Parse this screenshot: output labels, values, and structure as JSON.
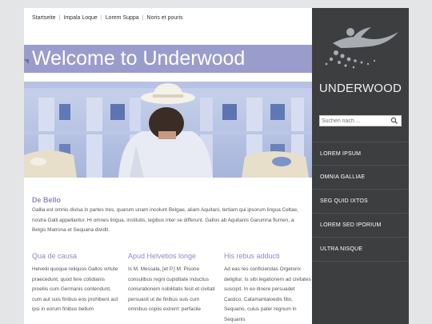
{
  "topnav": {
    "items": [
      "Startseite",
      "Impala Loque",
      "Lorem Suppa",
      "Noris et pouris"
    ]
  },
  "hero": {
    "title": "Welcome to Underwood"
  },
  "intro": {
    "title": "De Bello",
    "text": "Gallia est omnis divisa in partes tres, quarum unam incolunt Belgae, aliam Aquitani, tertiam qui ipsorum lingua Celtae, nostra Galli appellantur. Hi omnes lingua, institutis, legibus inter se differunt. Gallos ab Aquitanis Garumna flumen, a Belgis Matrona et Sequana dividit."
  },
  "columns": [
    {
      "title": "Qua de causa",
      "text": "Helvetii quoque reliquos Gallos virtute praecedunt, quod fere cotidianis proeliis cum Germanis contendunt, cum aut suis finibus eos prohibent aut ipsi in eorum finibus bellum"
    },
    {
      "title": "Apud Helvetios longe",
      "text": "Is M. Messala, [et P.] M. Pisone consulibus regni cupiditate inductus coniurationem nobilitatis fecit et civitati persuasit ut de finibus suis cum omnibus copiis exirent: perfacile"
    },
    {
      "title": "His rebus adducti",
      "text": "Ad eas res conficiendas Orgetorix deligitur. Is sibi legationem ad civitates suscipit. In eo itinere persuadet Castico, Catamantaloedis filio, Sequano, cuius pater regnum in Sequanis"
    }
  ],
  "sidebar": {
    "brand": "UNDERWOOD",
    "search_placeholder": "Suchen nach ...",
    "menu": [
      "LOREM IPSUM",
      "OMNIA GALLIAE",
      "SEG QUID IXTOS",
      "LOREM SED IPORIUM",
      "ULTRA NISQUE"
    ]
  },
  "colors": {
    "accent": "#9a9dcc",
    "heading": "#8f8bc6",
    "sidebar_bg": "#3c3e40",
    "page_bg": "#e3e5e7"
  },
  "icons": {
    "search": "magnifier",
    "logo": "swimmer-with-bubbles"
  }
}
